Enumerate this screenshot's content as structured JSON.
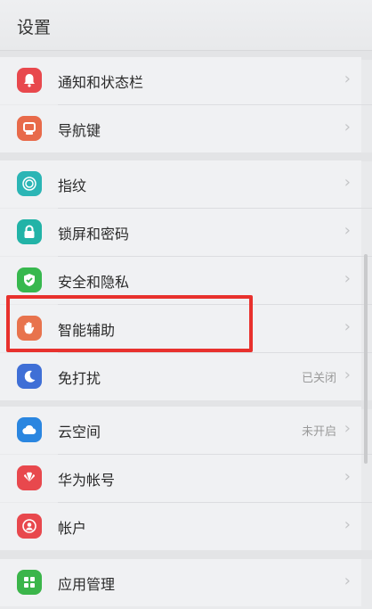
{
  "header": {
    "title": "设置"
  },
  "items": [
    {
      "label": "通知和状态栏",
      "icon": "bell-icon",
      "color": "#e8484d",
      "value": ""
    },
    {
      "label": "导航键",
      "icon": "navigation-keys-icon",
      "color": "#e86a4a",
      "value": ""
    },
    {
      "label": "指纹",
      "icon": "fingerprint-icon",
      "color": "#2bb5b5",
      "value": ""
    },
    {
      "label": "锁屏和密码",
      "icon": "lock-icon",
      "color": "#22b3a7",
      "value": ""
    },
    {
      "label": "安全和隐私",
      "icon": "shield-check-icon",
      "color": "#37b84e",
      "value": ""
    },
    {
      "label": "智能辅助",
      "icon": "hand-icon",
      "color": "#e8734d",
      "value": ""
    },
    {
      "label": "免打扰",
      "icon": "moon-icon",
      "color": "#3f6fd6",
      "value": "已关闭"
    },
    {
      "label": "云空间",
      "icon": "cloud-icon",
      "color": "#2a86e0",
      "value": "未开启"
    },
    {
      "label": "华为帐号",
      "icon": "huawei-logo-icon",
      "color": "#e8484d",
      "value": ""
    },
    {
      "label": "帐户",
      "icon": "user-account-icon",
      "color": "#e8484d",
      "value": ""
    },
    {
      "label": "应用管理",
      "icon": "apps-grid-icon",
      "color": "#3bb54a",
      "value": ""
    }
  ]
}
